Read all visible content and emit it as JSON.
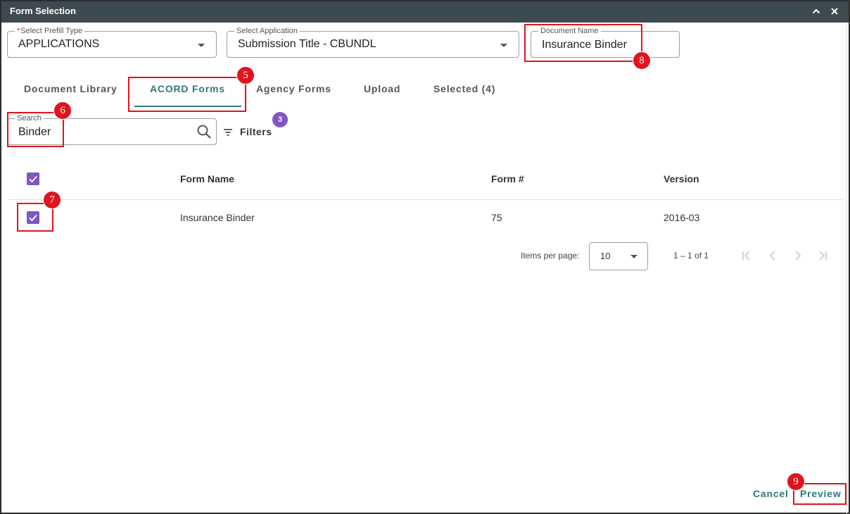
{
  "dialog": {
    "title": "Form Selection",
    "collapse_icon": "chevron-up-icon",
    "close_icon": "close-icon"
  },
  "fields": {
    "prefill_type": {
      "label": "Select Prefill Type",
      "required_mark": "*",
      "value": "APPLICATIONS"
    },
    "application": {
      "label": "Select Application",
      "value": "Submission Title - CBUNDL"
    },
    "document_name": {
      "label": "Document Name",
      "value": "Insurance Binder"
    }
  },
  "tabs": [
    {
      "label": "Document Library",
      "active": false
    },
    {
      "label": "ACORD Forms",
      "active": true
    },
    {
      "label": "Agency Forms",
      "active": false
    },
    {
      "label": "Upload",
      "active": false
    },
    {
      "label": "Selected (4)",
      "active": false
    }
  ],
  "search": {
    "label": "Search",
    "value": "Binder",
    "icon": "search-icon"
  },
  "filters": {
    "label": "Filters",
    "badge": "3",
    "icon": "filter-icon"
  },
  "table": {
    "columns": [
      "Form Name",
      "Form #",
      "Version"
    ],
    "header_checked": true,
    "rows": [
      {
        "checked": true,
        "form_name": "Insurance Binder",
        "form_number": "75",
        "version": "2016-03"
      }
    ]
  },
  "pagination": {
    "items_per_page_label": "Items per page:",
    "items_per_page": "10",
    "range": "1 – 1 of 1"
  },
  "footer": {
    "cancel": "Cancel",
    "preview": "Preview"
  },
  "annotations": [
    "5",
    "6",
    "7",
    "8",
    "9"
  ],
  "colors": {
    "accent": "#2b7a78",
    "checkbox": "#7e57c2",
    "annotation": "#e0141e",
    "titlebar": "#3e4a52"
  }
}
